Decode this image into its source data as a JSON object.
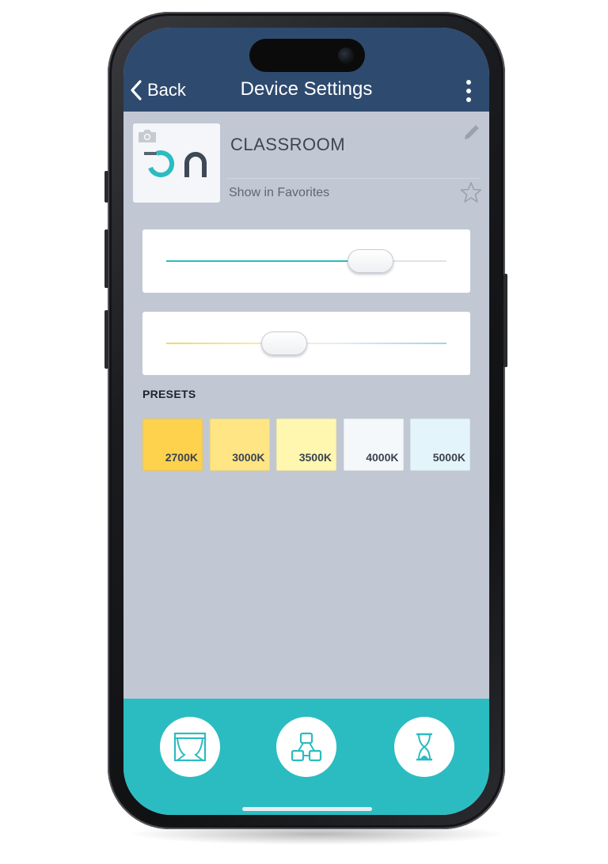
{
  "header": {
    "back_label": "Back",
    "title": "Device Settings",
    "menu_icon": "kebab-menu-icon"
  },
  "device": {
    "logo_text": "-on",
    "name": "CLASSROOM",
    "favorites_label": "Show in Favorites",
    "favorite": false
  },
  "sliders": {
    "brightness_level": 0.73,
    "color_temperature_level": 0.42
  },
  "presets": {
    "label": "PRESETS",
    "items": [
      {
        "label": "2700K",
        "color": "#ffd24d"
      },
      {
        "label": "3000K",
        "color": "#ffe584"
      },
      {
        "label": "3500K",
        "color": "#fff7b0"
      },
      {
        "label": "4000K",
        "color": "#f5f8fb"
      },
      {
        "label": "5000K",
        "color": "#e3f5fb"
      }
    ]
  },
  "colors": {
    "header_bg": "#2e4a6f",
    "screen_bg": "#c1c8d3",
    "accent_teal": "#2bbcc1",
    "warm_track": "#f2d860",
    "cool_track": "#9fd2ec"
  },
  "footer": {
    "nav_icons": [
      "scene-theater-icon",
      "group-network-icon",
      "hourglass-timer-icon"
    ]
  }
}
